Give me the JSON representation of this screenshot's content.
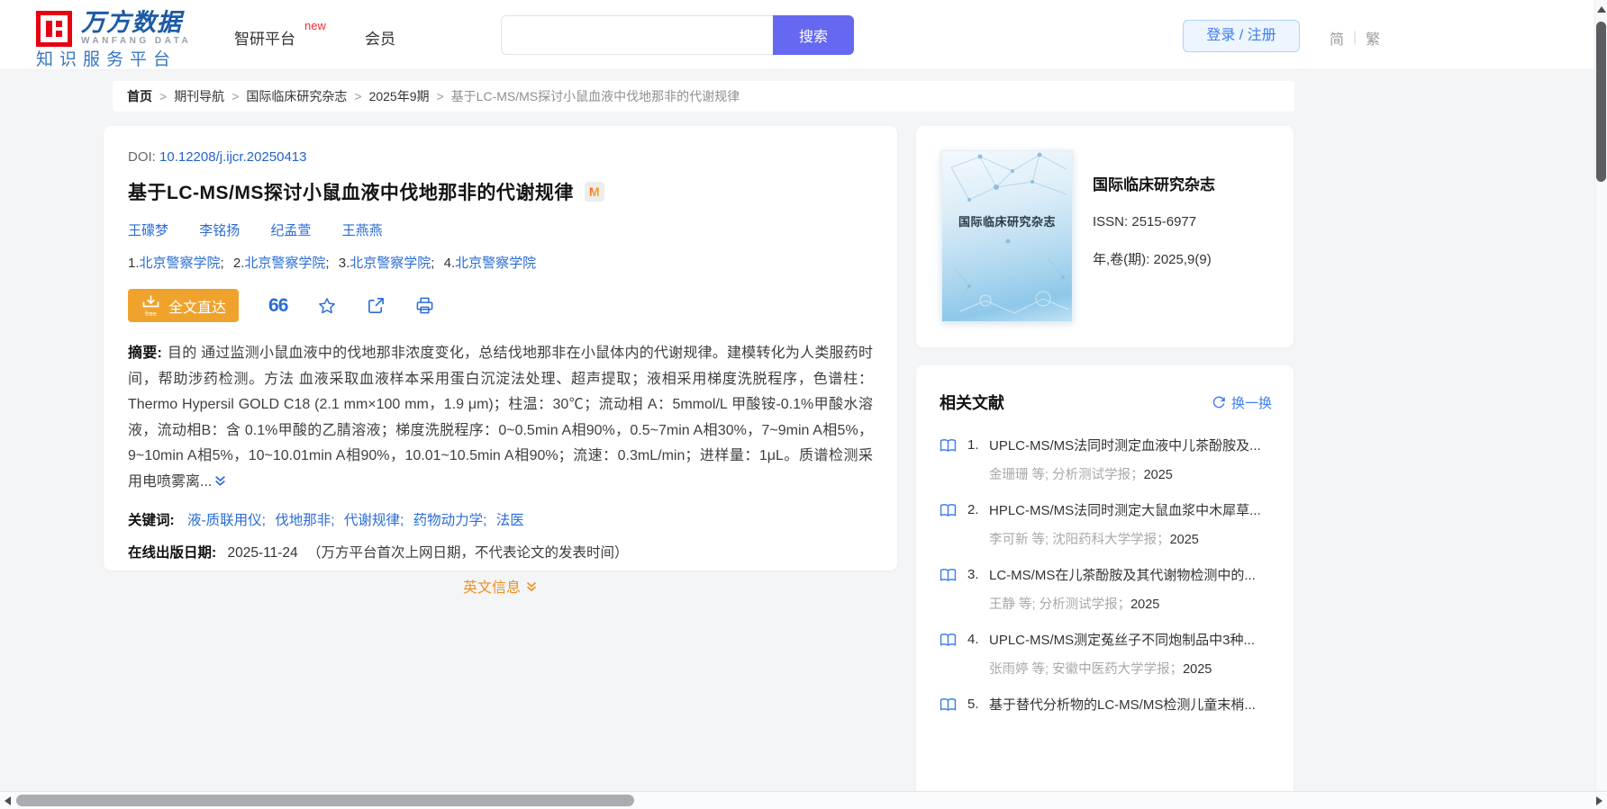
{
  "colors": {
    "brand_blue": "#1c5aa5",
    "brand_red": "#e60012",
    "link_blue": "#2b6cd4",
    "search_purple": "#6568f0",
    "login_blue": "#3f7df0",
    "orange_button": "#efa32d",
    "orange_link": "#ee8e1e"
  },
  "header": {
    "logo_cn": "万方数据",
    "logo_en": "WANFANG DATA",
    "logo_sub": "知识服务平台",
    "nav": [
      {
        "label": "智研平台",
        "badge": "new"
      },
      {
        "label": "会员"
      }
    ],
    "search": {
      "placeholder": "",
      "button": "搜索"
    },
    "login": "登录 / 注册",
    "lang": {
      "simplified": "简",
      "traditional": "繁"
    }
  },
  "separators": {
    "breadcrumb": ">",
    "keyword": ";",
    "affiliation": ";",
    "lang": "|"
  },
  "breadcrumb": {
    "items": [
      "首页",
      "期刊导航",
      "国际临床研究杂志",
      "2025年9期",
      "基于LC-MS/MS探讨小鼠血液中伐地那非的代谢规律"
    ]
  },
  "article": {
    "doi_label": "DOI:",
    "doi": "10.12208/j.ijcr.20250413",
    "title": "基于LC-MS/MS探讨小鼠血液中伐地那非的代谢规律",
    "badge": "M",
    "authors": [
      "王礞梦",
      "李铭扬",
      "纪孟萱",
      "王燕燕"
    ],
    "affiliations": [
      {
        "num": "1.",
        "name": "北京警察学院"
      },
      {
        "num": "2.",
        "name": "北京警察学院"
      },
      {
        "num": "3.",
        "name": "北京警察学院"
      },
      {
        "num": "4.",
        "name": "北京警察学院"
      }
    ],
    "fulltext_button": "全文直达",
    "fulltext_tag": "free",
    "abstract_label": "摘要:",
    "abstract": "目的 通过监测小鼠血液中的伐地那非浓度变化，总结伐地那非在小鼠体内的代谢规律。建模转化为人类服药时间，帮助涉药检测。方法 血液采取血液样本采用蛋白沉淀法处理、超声提取；液相采用梯度洗脱程序，色谱柱：Thermo Hypersil GOLD C18 (2.1 mm×100 mm，1.9 μm)；柱温：30℃；流动相 A：5mmol/L 甲酸铵-0.1%甲酸水溶液，流动相B：含 0.1%甲酸的乙腈溶液；梯度洗脱程序：0~0.5min A相90%，0.5~7min A相30%，7~9min A相5%，9~10min A相5%，10~10.01min A相90%，10.01~10.5min A相90%；流速：0.3mL/min；进样量：1μL。质谱检测采用电喷雾离...",
    "keywords_label": "关键词:",
    "keywords": [
      "液-质联用仪",
      "伐地那非",
      "代谢规律",
      "药物动力学",
      "法医"
    ],
    "pubdate_label": "在线出版日期:",
    "pubdate": "2025-11-24",
    "pubdate_note": "（万方平台首次上网日期，不代表论文的发表时间）",
    "english_link": "英文信息"
  },
  "journal": {
    "cover_title": "国际临床研究杂志",
    "name": "国际临床研究杂志",
    "issn_label": "ISSN:",
    "issn": "2515-6977",
    "volume_label": "年,卷(期):",
    "volume": "2025,9(9)"
  },
  "related": {
    "title": "相关文献",
    "refresh": "换一换",
    "items": [
      {
        "no": "1.",
        "title": "UPLC-MS/MS法同时测定血液中儿茶酚胺及...",
        "meta": "金珊珊  等;  分析测试学报；",
        "year": "2025"
      },
      {
        "no": "2.",
        "title": "HPLC-MS/MS法同时测定大鼠血浆中木犀草...",
        "meta": "李可新  等;  沈阳药科大学学报；",
        "year": "2025"
      },
      {
        "no": "3.",
        "title": "LC-MS/MS在儿茶酚胺及其代谢物检测中的...",
        "meta": "王静  等;  分析测试学报；",
        "year": "2025"
      },
      {
        "no": "4.",
        "title": "UPLC-MS/MS测定菟丝子不同炮制品中3种...",
        "meta": "张雨婷  等;  安徽中医药大学学报；",
        "year": "2025"
      },
      {
        "no": "5.",
        "title": "基于替代分析物的LC-MS/MS检测儿童末梢...",
        "meta": "",
        "year": ""
      }
    ]
  }
}
